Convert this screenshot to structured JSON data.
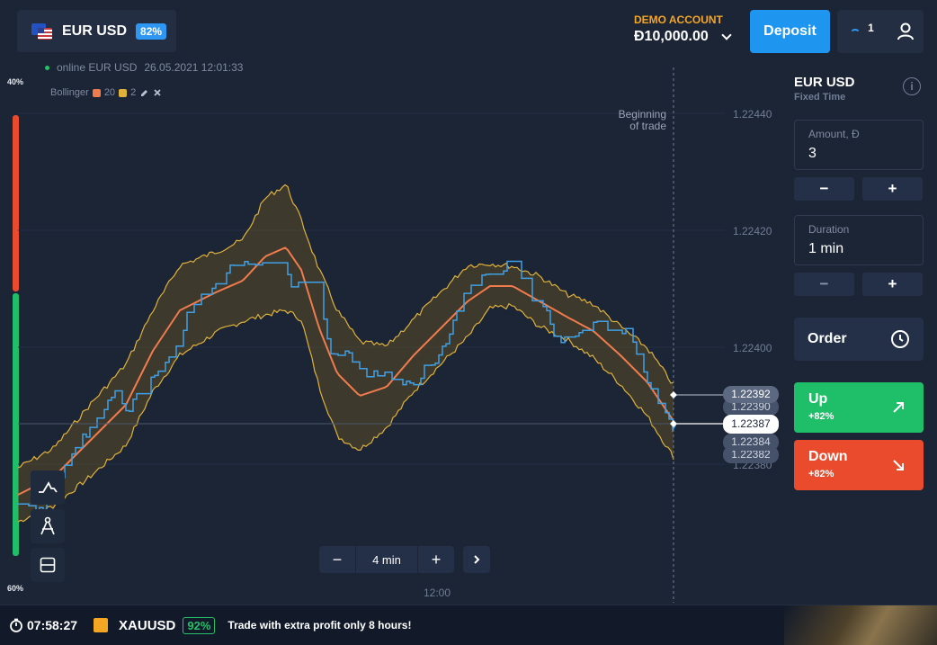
{
  "header": {
    "asset": "EUR USD",
    "asset_payout": "82%",
    "account_label": "DEMO ACCOUNT",
    "balance": "Đ10,000.00",
    "deposit_label": "Deposit",
    "open_trades_count": "1"
  },
  "chart": {
    "status": "online EUR USD",
    "timestamp": "26.05.2021 12:01:33",
    "indicator_name": "Bollinger",
    "indicator_period": "20",
    "indicator_deviation": "2",
    "sentiment_top": "40%",
    "sentiment_bottom": "60%",
    "marker_label_1": "Beginning",
    "marker_label_2": "of trade",
    "price_levels": [
      "1.22440",
      "1.22420",
      "1.22400",
      "1.22380"
    ],
    "time_label": "12:00",
    "price_tags": {
      "entry": "1.22392",
      "current": "1.22387",
      "stacked_1": "1.22390",
      "stacked_2": "1.22384",
      "stacked_3": "1.22382"
    },
    "zoom_value": "4 min",
    "colors": {
      "price_line": "#3fa0e6",
      "sma_line": "#f07b4d",
      "band_edge": "#e0b23a",
      "band_fill": "#5a4a26"
    }
  },
  "panel": {
    "title": "EUR USD",
    "subtitle": "Fixed Time",
    "amount_label": "Amount, Đ",
    "amount_value": "3",
    "duration_label": "Duration",
    "duration_value": "1 min",
    "order_label": "Order",
    "up_label": "Up",
    "up_payout": "+82%",
    "down_label": "Down",
    "down_payout": "+82%",
    "up_color": "#1fbf6a",
    "down_color": "#ea4b2d"
  },
  "footer": {
    "timer": "07:58:27",
    "symbol": "XAUUSD",
    "payout": "92%",
    "promo": "Trade with extra profit only 8 hours!"
  }
}
